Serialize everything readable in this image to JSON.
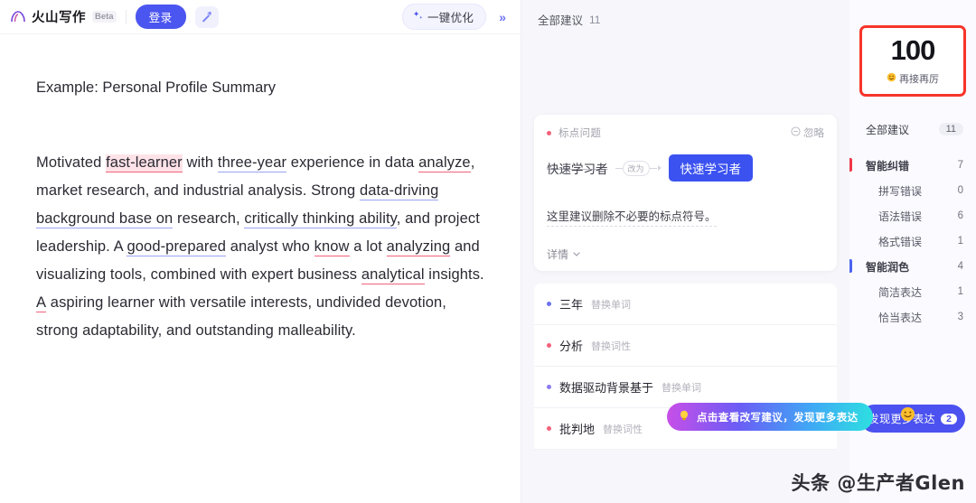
{
  "header": {
    "brand_name": "火山写作",
    "beta_label": "Beta",
    "login_label": "登录",
    "magic_icon": "magic-wand-icon",
    "optimize_label": "一键优化",
    "optimize_icon": "sparkle-icon",
    "collapse_icon": "double-chevron-right-icon"
  },
  "document": {
    "title": "Example: Personal Profile Summary",
    "paragraph_segments": [
      {
        "t": "Motivated ",
        "style": "plain"
      },
      {
        "t": "fast-learner",
        "style": "u-red-hl"
      },
      {
        "t": " with ",
        "style": "plain"
      },
      {
        "t": "three-year",
        "style": "u-blue"
      },
      {
        "t": " experience in data ",
        "style": "plain"
      },
      {
        "t": "analyze",
        "style": "u-red"
      },
      {
        "t": ", market research, and industrial analysis. Strong ",
        "style": "plain"
      },
      {
        "t": "data-driving background base on",
        "style": "u-blue"
      },
      {
        "t": " research, ",
        "style": "plain"
      },
      {
        "t": "critically thinking ability",
        "style": "u-blue"
      },
      {
        "t": ", and project leadership. A ",
        "style": "plain"
      },
      {
        "t": "good-prepared",
        "style": "u-blue"
      },
      {
        "t": " analyst who ",
        "style": "plain"
      },
      {
        "t": "know",
        "style": "u-red"
      },
      {
        "t": " a lot ",
        "style": "plain"
      },
      {
        "t": "analyzing",
        "style": "u-red"
      },
      {
        "t": " and visualizing tools, combined with expert business ",
        "style": "plain"
      },
      {
        "t": "analytical",
        "style": "u-red"
      },
      {
        "t": " insights. ",
        "style": "plain"
      },
      {
        "t": "A",
        "style": "u-red"
      },
      {
        "t": " aspiring learner with versatile interests, undivided devotion, strong adaptability, and outstanding malleability.",
        "style": "plain"
      }
    ]
  },
  "suggestions_panel": {
    "header_label": "全部建议",
    "header_count": "11",
    "active_card": {
      "type_label": "标点问题",
      "dot_color": "red",
      "ignore_label": "忽略",
      "ignore_icon": "minus-circle-icon",
      "old_word": "快速学习者",
      "arrow_chip_label": "改为",
      "new_word": "快速学习者",
      "description": "这里建议删除不必要的标点符号。",
      "more_label": "详情",
      "more_icon": "chevron-down-icon"
    },
    "rows": [
      {
        "word": "三年",
        "tag": "替换单词",
        "dot_color": "blue"
      },
      {
        "word": "分析",
        "tag": "替换词性",
        "dot_color": "red"
      },
      {
        "word": "数据驱动背景基于",
        "tag": "替换单词",
        "dot_color": "purple"
      },
      {
        "word": "批判地",
        "tag": "替换词性",
        "dot_color": "red"
      }
    ],
    "tooltip": {
      "icon": "lightbulb-icon",
      "text": "点击查看改写建议，发现更多表达"
    }
  },
  "sidebar": {
    "score": "100",
    "score_caption": "再接再厉",
    "score_emoji": "smile-emoji",
    "score_border_color": "#f8342a",
    "all_label": "全部建议",
    "all_count": "11",
    "categories": [
      {
        "label": "智能纠错",
        "count": "7",
        "level": 0,
        "bar": "red"
      },
      {
        "label": "拼写错误",
        "count": "0",
        "level": 1,
        "bar": ""
      },
      {
        "label": "语法错误",
        "count": "6",
        "level": 1,
        "bar": ""
      },
      {
        "label": "格式错误",
        "count": "1",
        "level": 1,
        "bar": ""
      },
      {
        "label": "智能润色",
        "count": "4",
        "level": 0,
        "bar": "blue"
      },
      {
        "label": "简洁表达",
        "count": "1",
        "level": 1,
        "bar": ""
      },
      {
        "label": "恰当表达",
        "count": "3",
        "level": 1,
        "bar": ""
      }
    ],
    "discover_label": "发现更多表达",
    "discover_count": "2"
  },
  "watermark": "头条 @生产者Glen"
}
